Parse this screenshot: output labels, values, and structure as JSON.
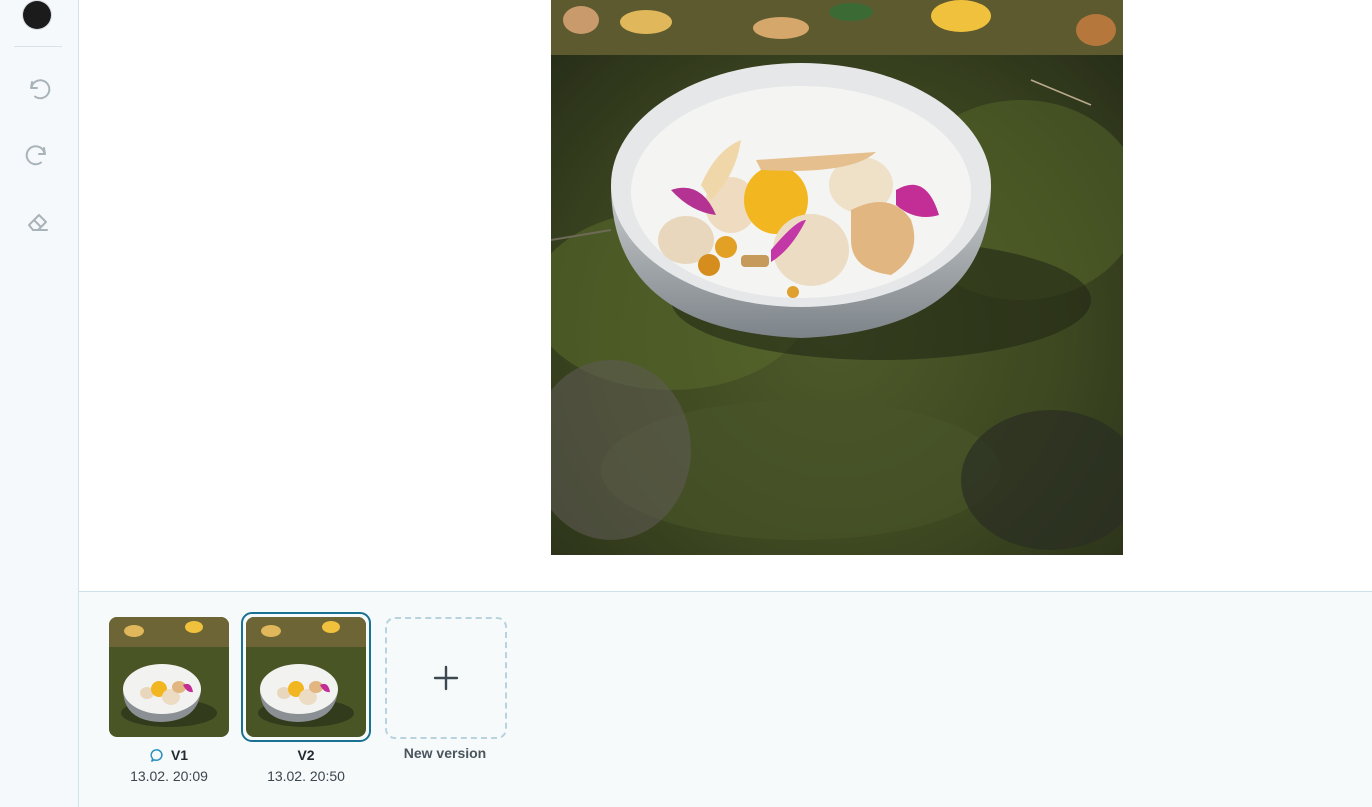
{
  "toolbar": {
    "color": "#1b1b1b",
    "tools": [
      {
        "name": "undo-icon"
      },
      {
        "name": "redo-icon"
      },
      {
        "name": "eraser-icon"
      }
    ]
  },
  "versions": [
    {
      "label": "V1",
      "date": "13.02. 20:09",
      "has_comment": true,
      "selected": false
    },
    {
      "label": "V2",
      "date": "13.02. 20:50",
      "has_comment": false,
      "selected": true
    }
  ],
  "new_version": {
    "label": "New version",
    "icon": "plus-icon"
  },
  "colors": {
    "accent": "#1b7191",
    "comment_icon": "#2a8fc0",
    "toolbar_bg": "#f6f9fb",
    "strip_bg": "#f7fafb"
  }
}
